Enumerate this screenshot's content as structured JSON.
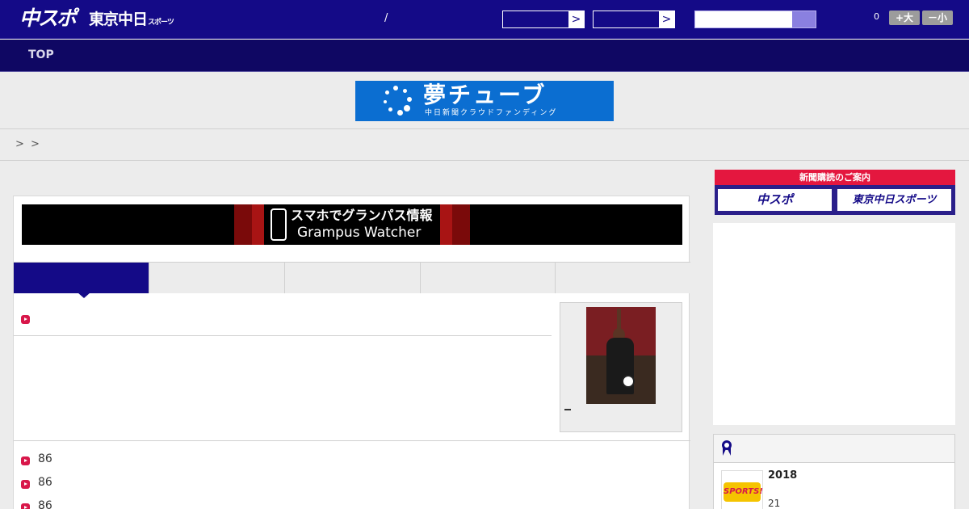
{
  "header": {
    "logo_chuspo": "中スポ",
    "logo_tokyo": "東京中日",
    "logo_tokyo_small": "スポーツ",
    "separator": "/",
    "select_arrow": ">",
    "font_size_count": "0",
    "font_larger_label": "+大",
    "font_smaller_label": "－小"
  },
  "nav": {
    "top_label": "TOP"
  },
  "banner": {
    "title": "夢チューブ",
    "subtitle": "中日新聞クラウドファンディング"
  },
  "breadcrumb": {
    "sep1": ">",
    "sep2": ">"
  },
  "grampus_banner": {
    "line1": "スマホでグランパス情報",
    "line2": "Grampus Watcher"
  },
  "list": {
    "items": [
      "86",
      "86",
      "86"
    ]
  },
  "sidebar": {
    "ad_header": "新聞購読のご案内",
    "ad_chuspo": "中スポ",
    "ad_tokyo": "東京中日スポーツ",
    "ranking": {
      "item_title": "2018",
      "item_sub": "21",
      "thumb_label": "SPORTS!"
    }
  },
  "colors": {
    "brand": "#140a87",
    "nav": "#0f0763",
    "accent": "#d8174a",
    "banner_blue": "#0b6ed1"
  }
}
